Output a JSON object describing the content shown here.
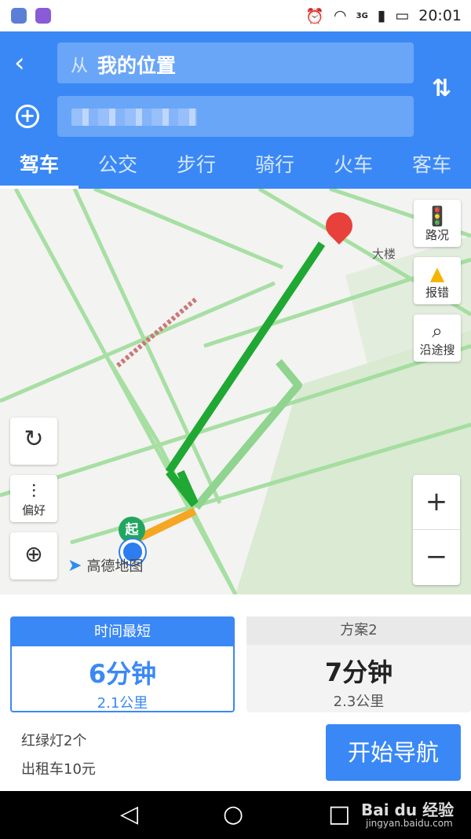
{
  "status_bar": {
    "network": "3G",
    "time": "20:01"
  },
  "header": {
    "from_prefix": "从",
    "from_value": "我的位置",
    "tabs": [
      {
        "label": "驾车"
      },
      {
        "label": "公交"
      },
      {
        "label": "步行"
      },
      {
        "label": "骑行"
      },
      {
        "label": "火车"
      },
      {
        "label": "客车"
      }
    ]
  },
  "map": {
    "traffic_label": "路况",
    "report_label": "报错",
    "along_search_label": "沿途搜",
    "preference_label": "偏好",
    "start_marker": "起",
    "logo_text": "高德地图",
    "building_suffix": "大楼",
    "zoom_in": "+",
    "zoom_out": "−"
  },
  "plans": [
    {
      "name": "时间最短",
      "duration": "6分钟",
      "distance": "2.1公里"
    },
    {
      "name": "方案2",
      "duration": "7分钟",
      "distance": "2.3公里"
    }
  ],
  "info": {
    "lights": "红绿灯2个",
    "taxi": "出租车10元"
  },
  "start_nav_label": "开始导航",
  "watermark": {
    "brand": "Bai du 经验",
    "url": "jingyan.baidu.com"
  },
  "colors": {
    "accent": "#3a88f5",
    "route_main": "#1fa833",
    "route_alt": "#8fd48f",
    "slow": "#f5a623"
  }
}
